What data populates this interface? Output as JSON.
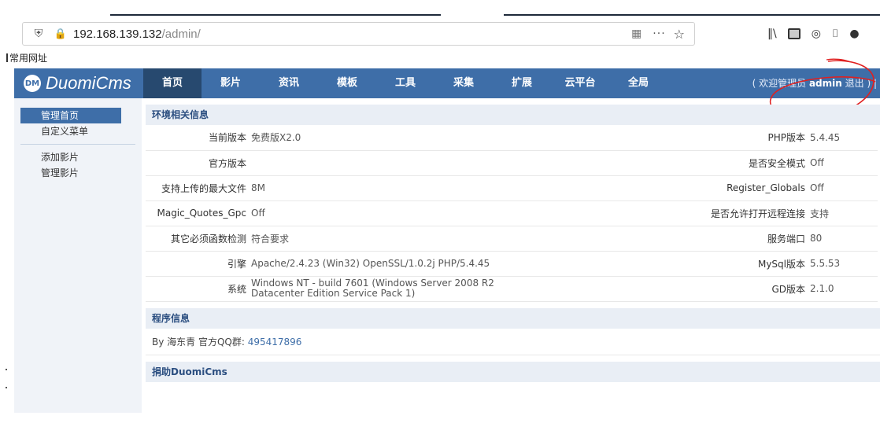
{
  "browser": {
    "url_host": "192.168.139.132",
    "url_path": "/admin/",
    "more_label": "···",
    "bookmark_label": "常用网址"
  },
  "cms": {
    "logo_badge": "DM",
    "logo_text": "DuomiCms",
    "nav": [
      "首页",
      "影片",
      "资讯",
      "模板",
      "工具",
      "采集",
      "扩展",
      "云平台",
      "全局"
    ],
    "welcome_prefix": "( 欢迎管理员 ",
    "welcome_user": "admin",
    "welcome_logout": "退出",
    "welcome_suffix": " ) |"
  },
  "sidebar": {
    "items": [
      "管理首页",
      "自定义菜单",
      "添加影片",
      "管理影片"
    ]
  },
  "env": {
    "title": "环境相关信息",
    "rows": [
      {
        "l1": "当前版本",
        "v1": "免费版X2.0",
        "l2": "PHP版本",
        "v2": "5.4.45"
      },
      {
        "l1": "官方版本",
        "v1": "",
        "l2": "是否安全模式",
        "v2": "Off"
      },
      {
        "l1": "支持上传的最大文件",
        "v1": "8M",
        "l2": "Register_Globals",
        "v2": "Off"
      },
      {
        "l1": "Magic_Quotes_Gpc",
        "v1": "Off",
        "l2": "是否允许打开远程连接",
        "v2": "支持"
      },
      {
        "l1": "其它必须函数检测",
        "v1": "符合要求",
        "l2": "服务端口",
        "v2": "80"
      },
      {
        "l1": "引擎",
        "v1": "Apache/2.4.23 (Win32) OpenSSL/1.0.2j PHP/5.4.45",
        "l2": "MySql版本",
        "v2": "5.5.53"
      },
      {
        "l1": "系统",
        "v1": "Windows NT - build 7601 (Windows Server 2008 R2 Datacenter Edition Service Pack 1)",
        "l2": "GD版本",
        "v2": "2.1.0"
      }
    ]
  },
  "program": {
    "title": "程序信息",
    "by_text": "By 海东青 官方QQ群: ",
    "qq": "495417896"
  },
  "donate": {
    "title": "捐助DuomiCms"
  },
  "colors": {
    "header_blue": "#3e6ea8",
    "active_tab": "#27496f",
    "annotation_red": "#e02020"
  }
}
